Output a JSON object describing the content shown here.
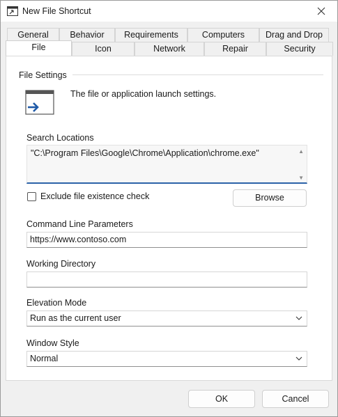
{
  "window": {
    "title": "New File Shortcut"
  },
  "tabs_row1": [
    "General",
    "Behavior",
    "Requirements",
    "Computers",
    "Drag and Drop"
  ],
  "tabs_row2": [
    "File",
    "Icon",
    "Network",
    "Repair",
    "Security"
  ],
  "active_tab": "File",
  "file_settings": {
    "group_label": "File Settings",
    "description": "The file or application launch settings.",
    "search_locations_label": "Search Locations",
    "search_locations_value": "\"C:\\Program Files\\Google\\Chrome\\Application\\chrome.exe\"",
    "exclude_check_label": "Exclude file existence check",
    "exclude_checked": false,
    "browse_label": "Browse",
    "command_line_label": "Command Line Parameters",
    "command_line_value": "https://www.contoso.com",
    "working_dir_label": "Working Directory",
    "working_dir_value": "",
    "elevation_label": "Elevation Mode",
    "elevation_value": "Run as the current user",
    "window_style_label": "Window Style",
    "window_style_value": "Normal"
  },
  "footer": {
    "ok_label": "OK",
    "cancel_label": "Cancel"
  },
  "colors": {
    "accent": "#2b62a8",
    "arrow": "#1f5aa8"
  },
  "icons": [
    "window-icon",
    "close-icon",
    "file-launch-icon",
    "scroll-up-icon",
    "scroll-down-icon",
    "chevron-down-icon"
  ]
}
